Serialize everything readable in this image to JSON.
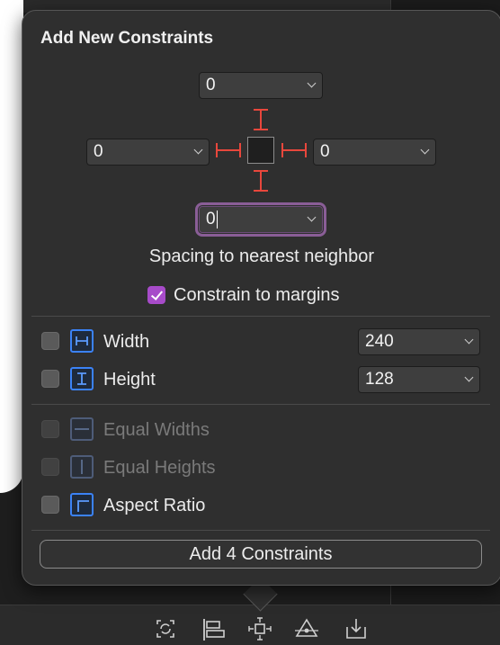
{
  "panel": {
    "title": "Add New Constraints",
    "spacing": {
      "top": "0",
      "left": "0",
      "right": "0",
      "bottom": "0"
    },
    "spacing_caption": "Spacing to nearest neighbor",
    "constrain_to_margins": {
      "label": "Constrain to margins",
      "checked": true
    },
    "width": {
      "label": "Width",
      "value": "240",
      "checked": false
    },
    "height": {
      "label": "Height",
      "value": "128",
      "checked": false
    },
    "equal_widths": {
      "label": "Equal Widths",
      "enabled": false
    },
    "equal_heights": {
      "label": "Equal Heights",
      "enabled": false
    },
    "aspect_ratio": {
      "label": "Aspect Ratio",
      "checked": false
    },
    "add_button": "Add 4 Constraints"
  },
  "toolbar": {
    "icons": [
      "update-frames-icon",
      "align-icon",
      "add-constraints-icon",
      "resolve-autolayout-icon",
      "embed-in-icon"
    ]
  },
  "colors": {
    "accent": "#a74bc9",
    "strut": "#e8473c",
    "constraint_icon": "#3b82f6",
    "focus_ring": "#8a5e97"
  }
}
